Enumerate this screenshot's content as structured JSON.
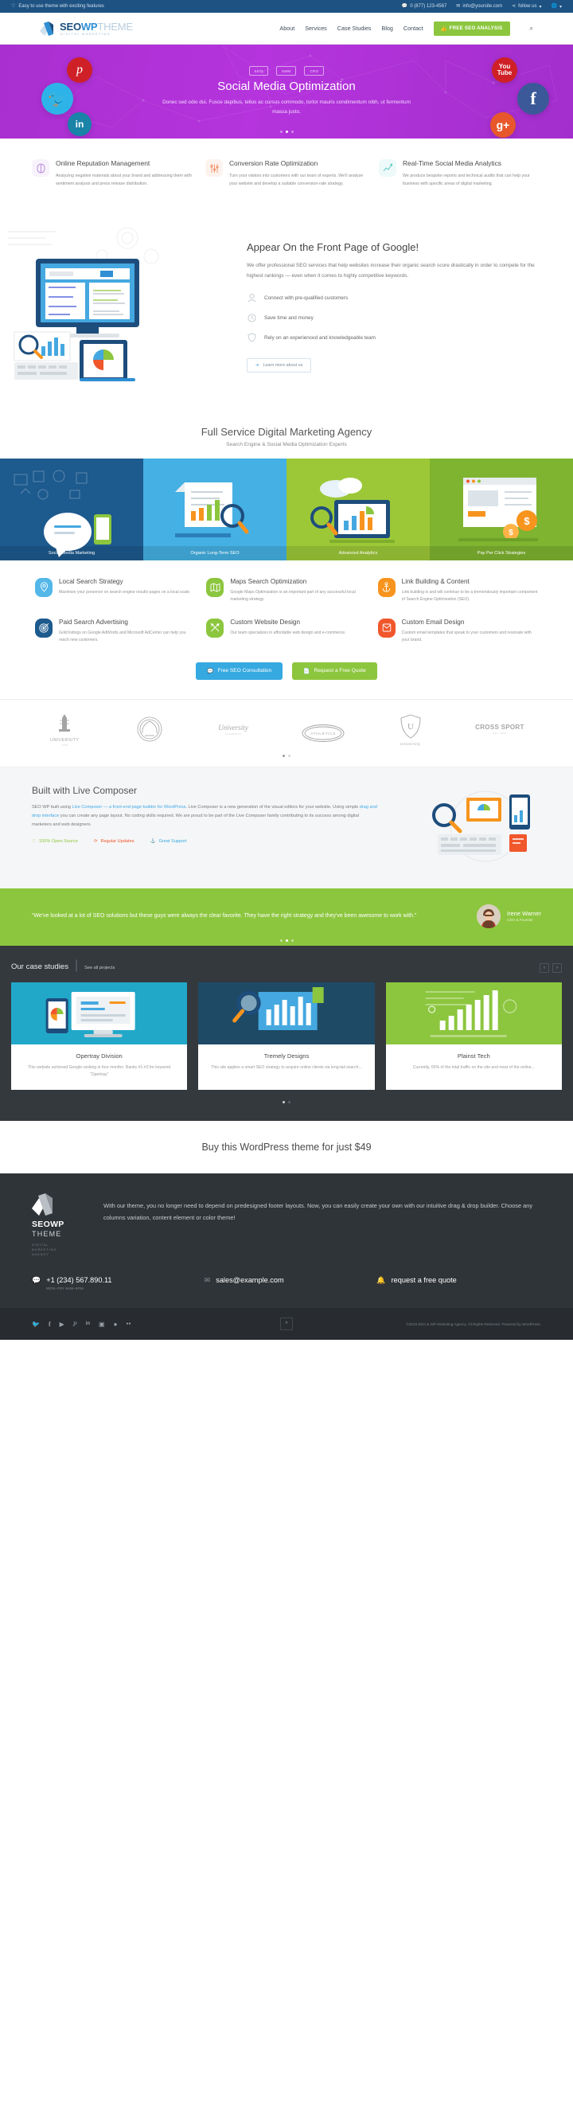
{
  "topbar": {
    "tagline": "Easy to use theme with exciting features",
    "phone": "0 (877) 123-4567",
    "email": "info@yoursite.com",
    "follow": "follow us",
    "heart_icon": "heart-icon",
    "chat_icon": "chat-icon",
    "mail_icon": "mail-icon",
    "share_icon": "share-icon",
    "globe_icon": "globe-icon"
  },
  "header": {
    "logo_seo": "SEO",
    "logo_wp": "WP",
    "logo_theme": "THEME",
    "logo_sub": "DIGITAL MARKETING",
    "nav": [
      {
        "label": "About"
      },
      {
        "label": "Services"
      },
      {
        "label": "Case Studies"
      },
      {
        "label": "Blog"
      },
      {
        "label": "Contact"
      }
    ],
    "cta": "FREE SEO ANALYSIS",
    "cta_icon": "thumbs-up-icon",
    "search_icon": "search-icon"
  },
  "hero": {
    "badges": [
      "SEO",
      "SMM",
      "CRO"
    ],
    "title": "Social Media Optimization",
    "description": "Donec sed odio dui. Fusce dapibus, tellus ac cursus commodo, tortor mauris condimentum nibh, ut fermentum massa justo.",
    "bg_color": "#b134dc",
    "social": [
      {
        "name": "pinterest-bubble",
        "glyph": "p",
        "color": "#cf2027"
      },
      {
        "name": "twitter-bubble",
        "glyph": "t",
        "color": "#2eb3e8"
      },
      {
        "name": "linkedin-bubble",
        "glyph": "in",
        "color": "#1983a8"
      },
      {
        "name": "youtube-bubble",
        "glyph": "You",
        "color": "#cf2027"
      },
      {
        "name": "facebook-bubble",
        "glyph": "f",
        "color": "#3b5998"
      },
      {
        "name": "googleplus-bubble",
        "glyph": "g+",
        "color": "#e8572b"
      }
    ],
    "dots": 3,
    "active_dot": 1
  },
  "features": [
    {
      "icon": "capsule-icon",
      "color": "#a86fd0",
      "bg": "#f8f2fc",
      "title": "Online Reputation Management",
      "text": "Analyzing negative materials about your brand and addressing them with sentiment analysis and press release distribution."
    },
    {
      "icon": "sliders-icon",
      "color": "#f08a5d",
      "bg": "#fdf3ee",
      "title": "Conversion Rate Optimization",
      "text": "Turn your visitors into customers with our team of experts. We'll analyze your website and develop a suitable conversion-rate strategy."
    },
    {
      "icon": "chart-line-icon",
      "color": "#4fc3bd",
      "bg": "#eefaf9",
      "title": "Real-Time Social Media Analytics",
      "text": "We produce bespoke reports and technical audits that can help your business with specific areas of digital marketing."
    }
  ],
  "google": {
    "title": "Appear On the Front Page of Google!",
    "lead": "We offer professional SEO services that help websites increase their organic search score drastically in order to compete for the highest rankings — even when it comes to highly competitive keywords.",
    "points": [
      {
        "icon": "user-icon",
        "label": "Connect with pre-qualified customers"
      },
      {
        "icon": "clock-icon",
        "label": "Save time and money"
      },
      {
        "icon": "shield-icon",
        "label": "Rely on an experienced and knowledgeable team"
      }
    ],
    "button": "Learn more about us",
    "button_icon": "arrow-right-icon"
  },
  "agency": {
    "title": "Full Service Digital Marketing Agency",
    "subtitle": "Search Engine & Social Media Optimization Experts"
  },
  "tiles": [
    {
      "label": "Social Media Marketing",
      "color": "#1d5a8e"
    },
    {
      "label": "Organic Long-Term SEO",
      "color": "#45b0e3"
    },
    {
      "label": "Advanced Analytics",
      "color": "#9cc838"
    },
    {
      "label": "Pay Per Click Strategies",
      "color": "#7fb430"
    }
  ],
  "services": [
    {
      "icon": "map-pin-icon",
      "color": "#53b7e8",
      "title": "Local Search Strategy",
      "text": "Maximize your presence on search engine results pages on a local scale."
    },
    {
      "icon": "map-icon",
      "color": "#8cc63e",
      "title": "Maps Search Optimization",
      "text": "Google Maps Optimization is an important part of any successful local marketing strategy."
    },
    {
      "icon": "anchor-icon",
      "color": "#f7941e",
      "title": "Link Building & Content",
      "text": "Link building is and will continue to be a tremendously important component of Search Engine Optimization (SEO)."
    },
    {
      "icon": "target-icon",
      "color": "#1d5a8e",
      "title": "Paid Search Advertising",
      "text": "Gold listings on Google AdWords and Microsoft AdCenter can help you reach new customers."
    },
    {
      "icon": "pencil-ruler-icon",
      "color": "#8cc63e",
      "title": "Custom Website Design",
      "text": "Our team specializes in affordable web design and e-commerce."
    },
    {
      "icon": "envelope-icon",
      "color": "#f0572b",
      "title": "Custom Email Design",
      "text": "Custom email templates that speak to your customers and resonate with your brand."
    }
  ],
  "buttons": {
    "consultation": "Free SEO Consultation",
    "consultation_icon": "comment-icon",
    "quote": "Request a Free Quote",
    "quote_icon": "file-icon"
  },
  "clients": [
    {
      "name": "UNIVERSITY",
      "sub": "1896",
      "icon": "lighthouse-icon"
    },
    {
      "name": "",
      "sub": "",
      "icon": "wreath-icon"
    },
    {
      "name": "University",
      "sub": "ACADEMICS",
      "icon": "script-icon"
    },
    {
      "name": "ATHLETICS",
      "sub": "",
      "icon": "oval-icon"
    },
    {
      "name": "University",
      "sub": "",
      "icon": "shield-u-icon"
    },
    {
      "name": "CROSS SPORT",
      "sub": "EST. 2009",
      "icon": "crosssport-icon"
    }
  ],
  "client_dots": 2,
  "client_active": 0,
  "livecomposer": {
    "title": "Built with Live Composer",
    "p1_a": "SEO WP built using ",
    "p1_link1": "Live Composer — a front-end page builder for WordPress",
    "p1_b": ". Live Composer is a new generation of the visual editors for your website. Using simple ",
    "p1_link2": "drag and drop interface",
    "p1_c": " you can create any page layout. No coding skills required. We are proud to be part of the Live Composer family contributing to its success among digital marketers and web designers.",
    "features": [
      {
        "icon": "heart-icon",
        "label": "100% Open Source",
        "color": "#8cc63e"
      },
      {
        "icon": "refresh-icon",
        "label": "Regular Updates",
        "color": "#f0572b"
      },
      {
        "icon": "anchor-icon",
        "label": "Great Support",
        "color": "#36a9e1"
      }
    ]
  },
  "testimonial": {
    "quote": "“We've looked at a lot of SEO solutions but these guys were always the clear favorite. They have the right strategy and they've been awesome to work with.”",
    "author": "Irene Warner",
    "role": "CEO & Founder",
    "dots": 3,
    "active_dot": 1
  },
  "casestudies": {
    "title": "Our case studies",
    "see_all": "See all projects",
    "prev_icon": "chevron-left-icon",
    "next_icon": "chevron-right-icon",
    "cards": [
      {
        "title": "Opertray Division",
        "text": "This website achieved Google ranking in four months: Ranks #1-#3 for keyword “Opertray”",
        "color": "#21a8c9"
      },
      {
        "title": "Tremely Designs",
        "text": "This site applies a smart SEO strategy to acquire online clients via long-tail search...",
        "color": "#1e4a66"
      },
      {
        "title": "Plainst Tech",
        "text": "Currently, 65% of the total traffic on the site and most of the online...",
        "color": "#8cc63e"
      }
    ],
    "dots": 2,
    "active_dot": 0
  },
  "buy": {
    "text": "Buy this WordPress theme for just $49"
  },
  "footer": {
    "logo_main": "SEOWP",
    "logo_second": "THEME",
    "logo_sub": "DIGITAL\nMARKETING\nAGENCY",
    "text": "With our theme, you no longer need to depend on predesigned footer layouts. Now, you can easily create your own with our intuitive drag & drop builder. Choose any columns variation, content element or color theme!",
    "contacts": [
      {
        "icon": "chat-icon",
        "value": "+1 (234) 567.890.11",
        "sub": "MON–FRI 9AM–6PM"
      },
      {
        "icon": "mail-icon",
        "value": "sales@example.com",
        "sub": ""
      },
      {
        "icon": "bell-icon",
        "value": "request a free quote",
        "sub": ""
      }
    ],
    "social": [
      {
        "icon": "twitter-icon",
        "glyph": "🐦"
      },
      {
        "icon": "facebook-icon",
        "glyph": "f"
      },
      {
        "icon": "youtube-icon",
        "glyph": "▶"
      },
      {
        "icon": "pinterest-icon",
        "glyph": "P"
      },
      {
        "icon": "linkedin-icon",
        "glyph": "in"
      },
      {
        "icon": "instagram-icon",
        "glyph": "▣"
      },
      {
        "icon": "github-icon",
        "glyph": "●"
      },
      {
        "icon": "flickr-icon",
        "glyph": "●●"
      }
    ],
    "top_icon": "chevron-up-icon",
    "copyright": "©2016 SEO & WP Marketing Agency. All Rights Reserved. Powered by WordPress."
  }
}
